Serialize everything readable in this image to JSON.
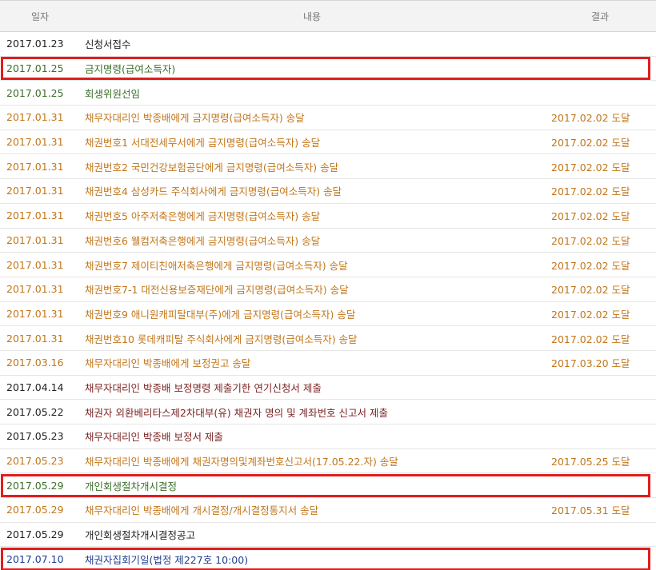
{
  "colors": {
    "black": "#222222",
    "green": "#3a6e2a",
    "orange": "#c2761a",
    "maroon": "#7d2323",
    "blue": "#1f3f95",
    "highlight": "#e01e1e"
  },
  "header": {
    "date": "일자",
    "content": "내용",
    "result": "결과"
  },
  "rows": [
    {
      "date": "2017.01.23",
      "content": "신청서접수",
      "result": "",
      "color": "#222222"
    },
    {
      "date": "2017.01.25",
      "content": "금지명령(급여소득자)",
      "result": "",
      "color": "#3a6e2a"
    },
    {
      "date": "2017.01.25",
      "content": "회생위원선임",
      "result": "",
      "color": "#3a6e2a"
    },
    {
      "date": "2017.01.31",
      "content": "채무자대리인 박종배에게 금지명령(급여소득자) 송달",
      "result": "2017.02.02 도달",
      "color": "#c2761a"
    },
    {
      "date": "2017.01.31",
      "content": "채권번호1 서대전세무서에게 금지명령(급여소득자) 송달",
      "result": "2017.02.02 도달",
      "color": "#c2761a"
    },
    {
      "date": "2017.01.31",
      "content": "채권번호2 국민건강보험공단에게 금지명령(급여소득자) 송달",
      "result": "2017.02.02 도달",
      "color": "#c2761a"
    },
    {
      "date": "2017.01.31",
      "content": "채권번호4 삼성카드 주식회사에게 금지명령(급여소득자) 송달",
      "result": "2017.02.02 도달",
      "color": "#c2761a"
    },
    {
      "date": "2017.01.31",
      "content": "채권번호5 아주저축은행에게 금지명령(급여소득자) 송달",
      "result": "2017.02.02 도달",
      "color": "#c2761a"
    },
    {
      "date": "2017.01.31",
      "content": "채권번호6 웰컴저축은행에게 금지명령(급여소득자) 송달",
      "result": "2017.02.02 도달",
      "color": "#c2761a"
    },
    {
      "date": "2017.01.31",
      "content": "채권번호7 제이티친애저축은행에게 금지명령(급여소득자) 송달",
      "result": "2017.02.02 도달",
      "color": "#c2761a"
    },
    {
      "date": "2017.01.31",
      "content": "채권번호7-1 대전신용보증재단에게 금지명령(급여소득자) 송달",
      "result": "2017.02.02 도달",
      "color": "#c2761a"
    },
    {
      "date": "2017.01.31",
      "content": "채권번호9 애니원캐피탈대부(주)에게 금지명령(급여소득자) 송달",
      "result": "2017.02.02 도달",
      "color": "#c2761a"
    },
    {
      "date": "2017.01.31",
      "content": "채권번호10 롯데캐피탈 주식회사에게 금지명령(급여소득자) 송달",
      "result": "2017.02.02 도달",
      "color": "#c2761a"
    },
    {
      "date": "2017.03.16",
      "content": "채무자대리인 박종배에게 보정권고 송달",
      "result": "2017.03.20 도달",
      "color": "#c2761a"
    },
    {
      "date": "2017.04.14",
      "content": "채무자대리인 박종배 보정명령 제출기한 연기신청서 제출",
      "result": "",
      "color": "#7d2323",
      "date_color": "#222222"
    },
    {
      "date": "2017.05.22",
      "content": "채권자 외환베리타스제2차대부(유) 채권자 명의 및 계좌번호 신고서 제출",
      "result": "",
      "color": "#7d2323",
      "date_color": "#222222"
    },
    {
      "date": "2017.05.23",
      "content": "채무자대리인 박종배 보정서 제출",
      "result": "",
      "color": "#7d2323",
      "date_color": "#222222"
    },
    {
      "date": "2017.05.23",
      "content": "채무자대리인 박종배에게 채권자명의및계좌번호신고서(17.05.22.자) 송달",
      "result": "2017.05.25 도달",
      "color": "#c2761a"
    },
    {
      "date": "2017.05.29",
      "content": "개인회생절차개시결정",
      "result": "",
      "color": "#3a6e2a"
    },
    {
      "date": "2017.05.29",
      "content": "채무자대리인 박종배에게 개시결정/개시결정통지서 송달",
      "result": "2017.05.31 도달",
      "color": "#c2761a"
    },
    {
      "date": "2017.05.29",
      "content": "개인회생절차개시결정공고",
      "result": "",
      "color": "#222222"
    },
    {
      "date": "2017.07.10",
      "content": "채권자집회기일(법정 제227호 10:00)",
      "result": "",
      "color": "#1f3f95"
    }
  ],
  "highlighted_rows": [
    1,
    18,
    21
  ]
}
